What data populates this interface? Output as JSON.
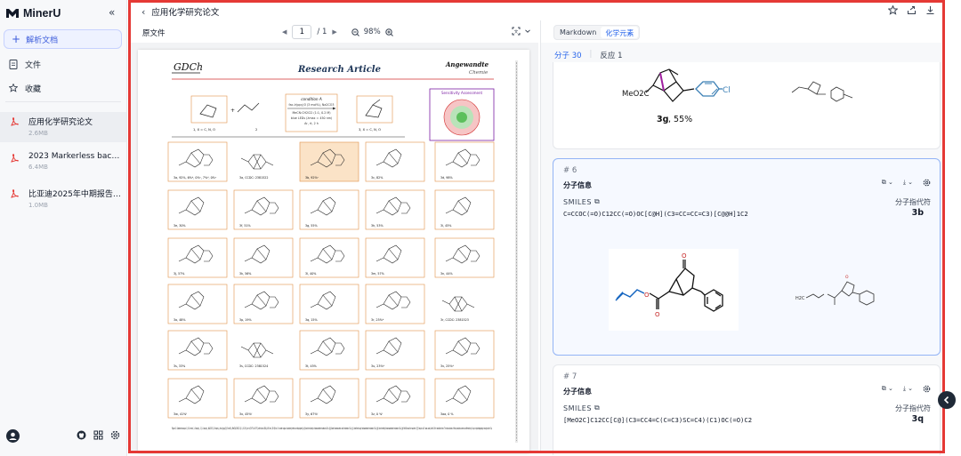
{
  "app": {
    "name": "MinerU"
  },
  "sidebar": {
    "new_button": "解析文档",
    "nav": [
      {
        "label": "文件",
        "icon": "file-icon"
      },
      {
        "label": "收藏",
        "icon": "star-icon"
      }
    ],
    "documents": [
      {
        "name": "应用化学研究论文",
        "size": "2.6MB",
        "active": true
      },
      {
        "name": "2023 Markerless bacteria…",
        "size": "6.4MB",
        "active": false
      },
      {
        "name": "比亚迪2025年中期报告分…",
        "size": "1.0MB",
        "active": false
      }
    ]
  },
  "header": {
    "title": "应用化学研究论文"
  },
  "left_pane": {
    "label": "原文件",
    "page_current": "1",
    "page_total": "/ 1",
    "zoom": "98%"
  },
  "pdf": {
    "journal_logo": "GDCh",
    "article_type": "Research Article",
    "publisher": "Angewandte",
    "publisher_sub": "Chemie",
    "scheme_condition_title": "condition A",
    "scheme_condition_lines": [
      "fac-Ir(ppy)3 (3 mol%), Na2CO3",
      "MeCN:CH2Cl2 (1:1, 0.2 M)",
      "blue LEDs (λmax = 450 nm)",
      "Ar, rt, 2 h"
    ],
    "sensitivity_title": "Sensitivity Assessment",
    "scheme_labels": [
      "1, X = C, N, O",
      "2",
      "3, X = C, N, O"
    ],
    "compounds": [
      [
        "3a, 92%, 6%ᵇ, 0%ᶜ, 7%ᵈ, 0%ᵉ",
        "3a, CCDC: 2381522",
        "3b, 92%ᵉ",
        "3c, 82%",
        "3d, 98%"
      ],
      [
        "3e, 30%",
        "3f, 51%",
        "3g, 55%",
        "3h, 53%",
        "3i, 45%"
      ],
      [
        "3j, 57%",
        "3k, 56%",
        "3l, 40%",
        "3m, 57%",
        "3n, 44%"
      ],
      [
        "3o, 48%",
        "3p, 19%",
        "3q, 15%",
        "3r, 25%ᵈ",
        "3r, CCDC: 2381523"
      ],
      [
        "3s, 33%",
        "3s, CCDC: 2381524",
        "3t, 45%",
        "3u, 23%ᵈ",
        "3v, 25%ᵈ"
      ],
      [
        "3w, 41%ᶠ",
        "3x, 45%ᶠ",
        "3y, 67%ᶠ",
        "3z, 0 %ᶠ",
        "3aa, 0 %"
      ]
    ],
    "caption": "Figure 2. Substrate scope. 1 (0.2 mmol, 1.0 equiv.), 2 (1.1 equiv.), Na2CO3 (2.0 equiv.), fac-Ir(ppy)3 (3 mol%), MeCN/CH2Cl2 (1:1, 0.2 M), at rt (30°C to 35°C) with blue LEDs (450 nm, 30 W) for 2 h under argon. Isolated yields are displayed. [a] Used tert-butyl chloroacetate instead of 2a. [b] Used bromoacetic acid instead of 2a. [c] Used tert-butyl iodoacetate instead of 2a. [d] Used methyl bromoacetate instead of 2a. [e] MeCN was the solvent. [f] 5 equiv. of 2 was used, with 16 h reaction time. The structures of the products were confirmed by X-ray crystallography analysis for 3a,"
  },
  "right_pane": {
    "tabs": [
      {
        "label": "Markdown",
        "active": false
      },
      {
        "label": "化学元素",
        "active": true
      }
    ],
    "subtab_molecules": "分子 30",
    "subtab_reactions": "反应 1",
    "card_top": {
      "formula_label": "MeO2C",
      "substituent": "Cl",
      "compound": "3g",
      "yield": ", 55%"
    },
    "cards": [
      {
        "index": "# 6",
        "section": "分子信息",
        "smiles_label": "SMILES",
        "smiles": "C=CCOC(=O)C12CC(=O)OC[C@H](C3=CC=CC=C3)[C@@H]1C2",
        "ident_label": "分子指代符",
        "ident": "3b",
        "render_label": "H2C"
      },
      {
        "index": "# 7",
        "section": "分子信息",
        "smiles_label": "SMILES",
        "smiles": "[MeO2C]C12CC[C@](C3=CC4=C(C=C3)SC=C4)(C1)OC(=O)C2",
        "ident_label": "分子指代符",
        "ident": "3q"
      }
    ]
  },
  "colors": {
    "accent": "#2563eb",
    "selection_frame": "#e53935",
    "pdf_red": "#d32f2f",
    "highlight_card": "#fbe3c7",
    "sensitivity_border": "#7b1fa2"
  }
}
